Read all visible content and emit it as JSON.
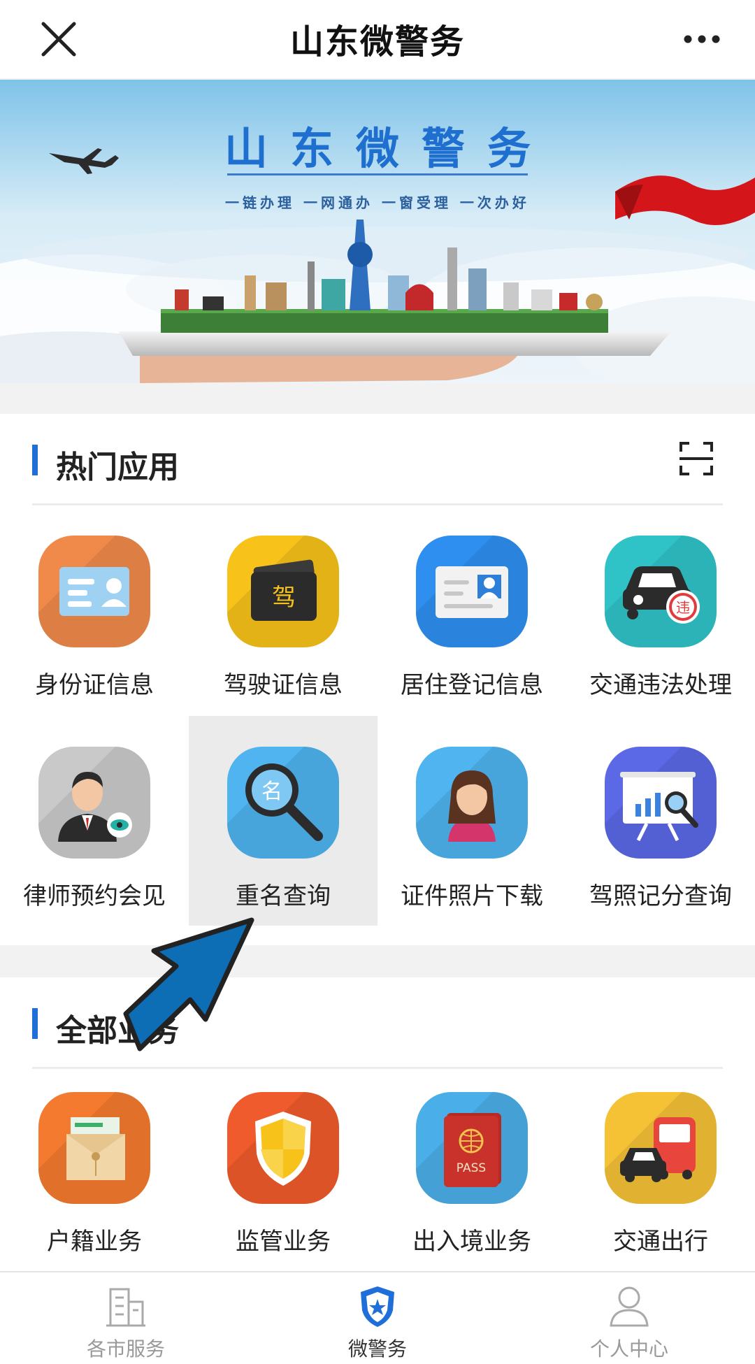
{
  "topbar": {
    "title": "山东微警务"
  },
  "banner": {
    "title": "山东微警务",
    "slogan": "一链办理  一网通办  一窗受理  一次办好"
  },
  "hot_section": {
    "title": "热门应用",
    "items": [
      {
        "label": "身份证信息",
        "icon": "id-card-icon",
        "color": "#f08a4b"
      },
      {
        "label": "驾驶证信息",
        "icon": "driver-license-icon",
        "color": "#f7c21a"
      },
      {
        "label": "居住登记信息",
        "icon": "residence-card-icon",
        "color": "#2e8ff0"
      },
      {
        "label": "交通违法处理",
        "icon": "traffic-violation-car-icon",
        "color": "#2fc3c8"
      },
      {
        "label": "律师预约会见",
        "icon": "lawyer-icon",
        "color": "#c9c9c9"
      },
      {
        "label": "重名查询",
        "icon": "name-search-icon",
        "color": "#4fb4ef"
      },
      {
        "label": "证件照片下载",
        "icon": "id-photo-icon",
        "color": "#4fb4ef"
      },
      {
        "label": "驾照记分查询",
        "icon": "license-points-chart-icon",
        "color": "#5b69e6"
      }
    ]
  },
  "all_section": {
    "title": "全部业务",
    "items": [
      {
        "label": "户籍业务",
        "icon": "household-register-icon",
        "color": "#f37a2e"
      },
      {
        "label": "监管业务",
        "icon": "supervision-shield-icon",
        "color": "#ef5b2c"
      },
      {
        "label": "出入境业务",
        "icon": "passport-icon",
        "color": "#4aaee8",
        "badge_text": "PASS"
      },
      {
        "label": "交通出行",
        "icon": "bus-car-icon",
        "color": "#f5c236"
      }
    ]
  },
  "tabbar": {
    "tabs": [
      {
        "label": "各市服务",
        "icon": "city-building-icon",
        "active": false
      },
      {
        "label": "微警务",
        "icon": "police-shield-icon",
        "active": true
      },
      {
        "label": "个人中心",
        "icon": "person-icon",
        "active": false
      }
    ]
  },
  "colors": {
    "accent": "#1e6fd9",
    "arrow": "#0d6db5"
  }
}
